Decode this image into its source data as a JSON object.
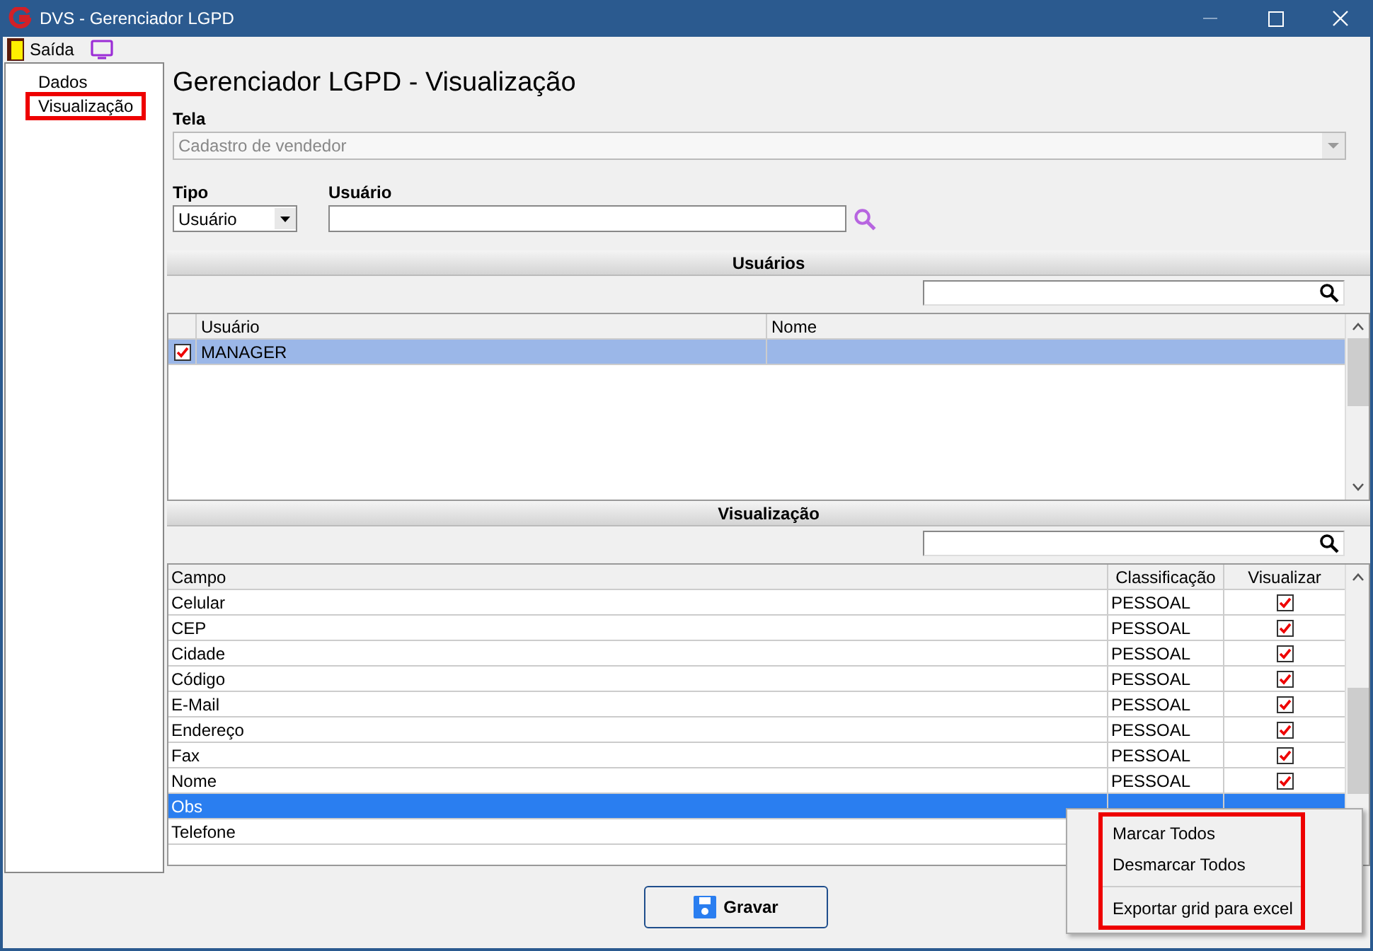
{
  "window": {
    "title": "DVS - Gerenciador LGPD"
  },
  "menu": [
    {
      "label": "Saída"
    }
  ],
  "tree": [
    {
      "label": "Dados",
      "selected": false
    },
    {
      "label": "Visualização",
      "selected": true
    }
  ],
  "heading": "Gerenciador LGPD - Visualização",
  "tela": {
    "label": "Tela",
    "value": "Cadastro de vendedor",
    "disabled": true
  },
  "tipo": {
    "label": "Tipo",
    "value": "Usuário"
  },
  "usuario": {
    "label": "Usuário"
  },
  "usuarios": {
    "title": "Usuários",
    "columns": [
      "Usuário",
      "Nome"
    ],
    "rows": [
      {
        "usuario": "MANAGER",
        "checked": true,
        "selected": true
      }
    ]
  },
  "visualizacao": {
    "title": "Visualização",
    "columns": [
      "Campo",
      "Classificação",
      "Visualizar"
    ],
    "rows": [
      {
        "campo": "Celular",
        "classificacao": "PESSOAL",
        "visualizar": true,
        "selected": false
      },
      {
        "campo": "CEP",
        "classificacao": "PESSOAL",
        "visualizar": true,
        "selected": false
      },
      {
        "campo": "Cidade",
        "classificacao": "PESSOAL",
        "visualizar": true,
        "selected": false
      },
      {
        "campo": "Código",
        "classificacao": "PESSOAL",
        "visualizar": true,
        "selected": false
      },
      {
        "campo": "E-Mail",
        "classificacao": "PESSOAL",
        "visualizar": true,
        "selected": false
      },
      {
        "campo": "Endereço",
        "classificacao": "PESSOAL",
        "visualizar": true,
        "selected": false
      },
      {
        "campo": "Fax",
        "classificacao": "PESSOAL",
        "visualizar": true,
        "selected": false
      },
      {
        "campo": "Nome",
        "classificacao": "PESSOAL",
        "visualizar": true,
        "selected": false
      },
      {
        "campo": "Obs",
        "selected": true
      },
      {
        "campo": "Telefone",
        "selected": false
      }
    ]
  },
  "save_button": "Gravar",
  "context_menu": [
    [
      "Marcar Todos",
      "Desmarcar Todos"
    ],
    [
      "Exportar grid para excel"
    ]
  ]
}
